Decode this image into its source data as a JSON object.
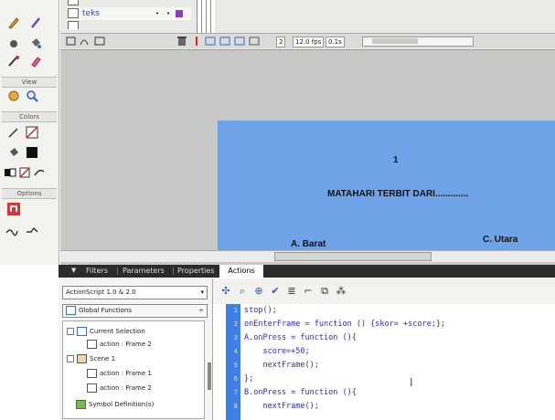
{
  "timeline": {
    "layers": [
      {
        "name": "",
        "icon": "layer-icon"
      },
      {
        "name": "teks",
        "icon": "layer-icon"
      },
      {
        "name": "",
        "icon": "layer-icon"
      }
    ],
    "frame_number": "2",
    "fps": "12.0 fps",
    "elapsed": "0.1s"
  },
  "tools": {
    "sections": {
      "view": "View",
      "colors": "Colors",
      "options": "Options"
    }
  },
  "stage": {
    "number": "1",
    "question": "MATAHARI TERBIT DARI.............",
    "option_a": "A. Barat",
    "option_c": "C. Utara",
    "background": "#6fa3e8"
  },
  "panel": {
    "tabs": [
      "Filters",
      "Parameters",
      "Properties"
    ],
    "active_tab": "Actions"
  },
  "actions": {
    "version_select": "ActionScript 1.0 & 2.0",
    "functions_select": "Global Functions",
    "tree": [
      {
        "label": "Current Selection",
        "indent": 0
      },
      {
        "label": "action : Frame 2",
        "indent": 1
      },
      {
        "label": "Scene 1",
        "indent": 0
      },
      {
        "label": "action : Frame 1",
        "indent": 1
      },
      {
        "label": "action : Frame 2",
        "indent": 1
      },
      {
        "label": "Symbol Definition(s)",
        "indent": 0
      }
    ],
    "code": [
      {
        "n": "1",
        "text": "stop();"
      },
      {
        "n": "2",
        "text": "onEnterFrame = function () {skor= +score;};"
      },
      {
        "n": "3",
        "text": "A.onPress = function (){"
      },
      {
        "n": "4",
        "text": "    score=+50;"
      },
      {
        "n": "5",
        "text": "    nextFrame();"
      },
      {
        "n": "6",
        "text": "};"
      },
      {
        "n": "7",
        "text": "B.onPress = function (){"
      },
      {
        "n": "8",
        "text": "    nextFrame();"
      }
    ]
  }
}
